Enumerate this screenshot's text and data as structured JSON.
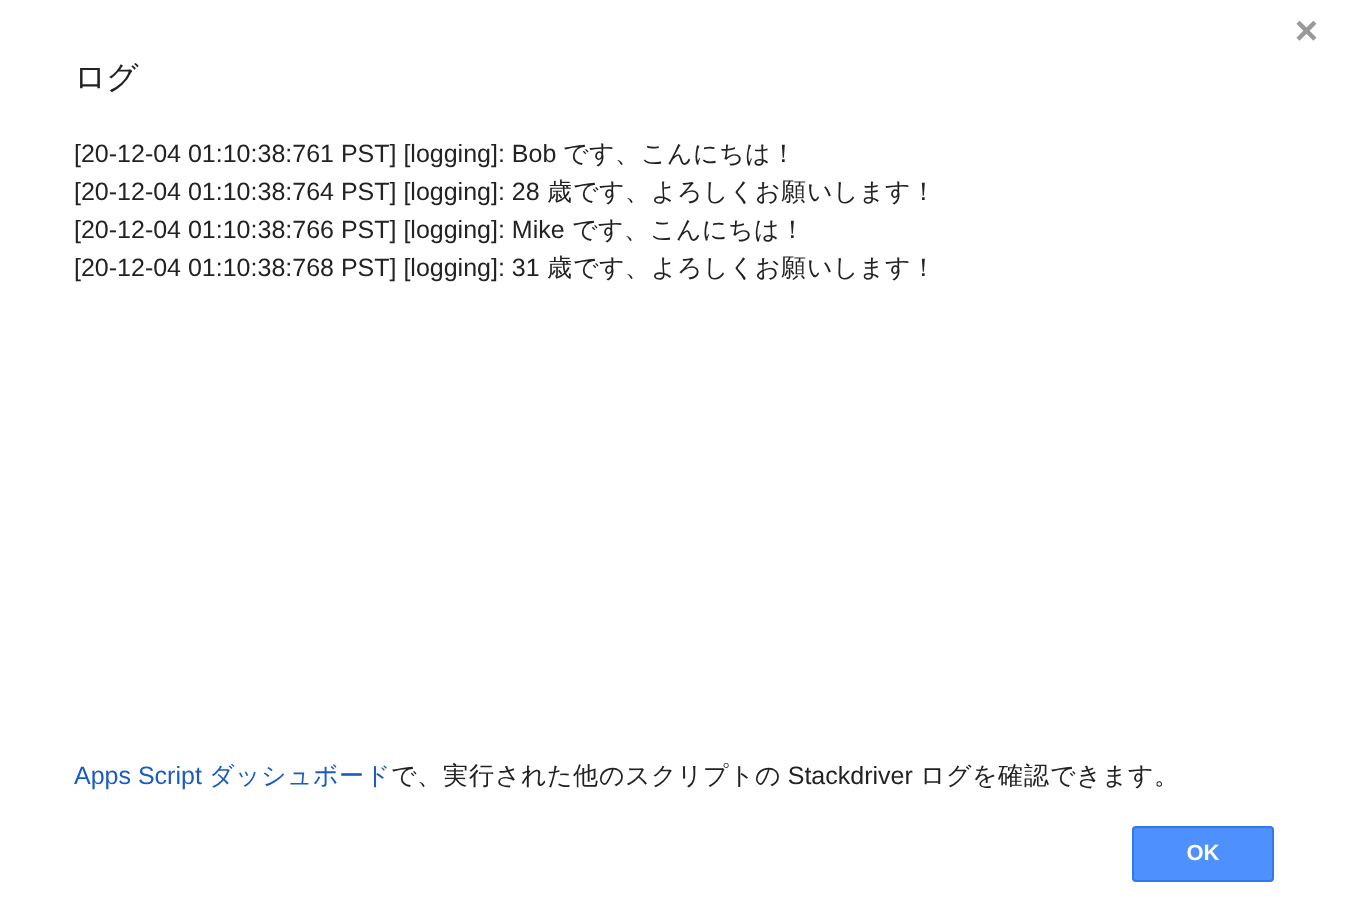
{
  "dialog": {
    "title": "ログ",
    "close": "×"
  },
  "log_lines": [
    "[20-12-04 01:10:38:761 PST] [logging]: Bob です、こんにちは！",
    "[20-12-04 01:10:38:764 PST] [logging]: 28 歳です、よろしくお願いします！",
    "[20-12-04 01:10:38:766 PST] [logging]: Mike です、こんにちは！",
    "[20-12-04 01:10:38:768 PST] [logging]: 31 歳です、よろしくお願いします！"
  ],
  "footer": {
    "link": "Apps Script ダッシュボード",
    "text": "で、実行された他のスクリプトの Stackdriver ログを確認できます。"
  },
  "buttons": [
    "OK"
  ]
}
